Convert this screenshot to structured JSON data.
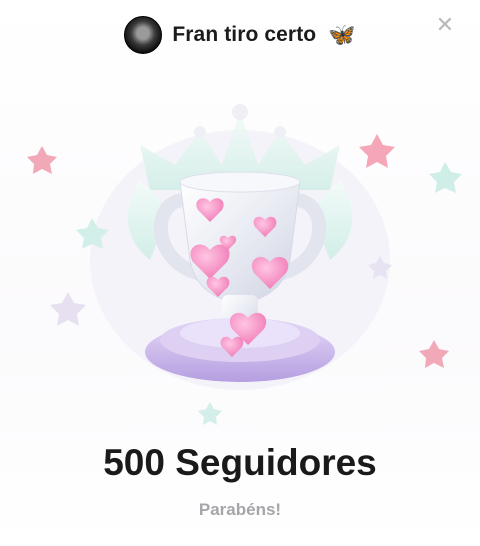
{
  "header": {
    "username": "Fran tiro certo",
    "emoji": "🦋",
    "avatar_icon": "avatar-photo",
    "close_icon": "close-icon"
  },
  "illustration": {
    "icon": "trophy-with-crown-and-hearts",
    "colors": {
      "pink": "#f48fc1",
      "lavender": "#c9b3ea",
      "mint": "#cfeee7",
      "silver": "#eef0f6"
    }
  },
  "main": {
    "title": "500 Seguidores",
    "subtitle": "Parabéns!"
  }
}
